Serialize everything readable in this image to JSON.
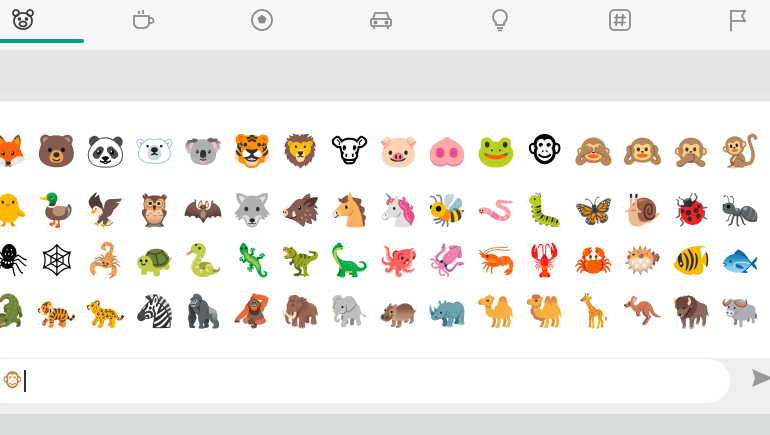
{
  "tabs": [
    {
      "id": "animals",
      "icon": "bear-face-icon",
      "selected": true
    },
    {
      "id": "food",
      "icon": "coffee-cup-icon",
      "selected": false
    },
    {
      "id": "activity",
      "icon": "soccer-ball-icon",
      "selected": false
    },
    {
      "id": "travel",
      "icon": "car-icon",
      "selected": false
    },
    {
      "id": "objects",
      "icon": "light-bulb-icon",
      "selected": false
    },
    {
      "id": "symbols",
      "icon": "hash-symbol-icon",
      "selected": false
    },
    {
      "id": "flags",
      "icon": "flag-icon",
      "selected": false
    }
  ],
  "colors": {
    "accent": "#0a9b86",
    "tab_icon": "#8a8a8a",
    "panel_bg": "#ffffff",
    "input_bg": "#ffffff"
  },
  "emoji_rows": [
    [
      "🦊",
      "🐻",
      "🐼",
      "🐻‍❄️",
      "🐨",
      "🐯",
      "🦁",
      "🐮",
      "🐷",
      "🐽",
      "🐸",
      "🐵",
      "🙈",
      "🙉",
      "🙊",
      "🐒"
    ],
    [
      "🐥",
      "🦆",
      "🦅",
      "🦉",
      "🦇",
      "🐺",
      "🐗",
      "🐴",
      "🦄",
      "🐝",
      "🪱",
      "🐛",
      "🦋",
      "🐌",
      "🐞",
      "🐜"
    ],
    [
      "🕷",
      "🕸",
      "🦂",
      "🐢",
      "🐍",
      "🦎",
      "🦖",
      "🦕",
      "🐙",
      "🦑",
      "🦐",
      "🦞",
      "🦀",
      "🐡",
      "🐠",
      "🐟"
    ],
    [
      "🐊",
      "🐅",
      "🐆",
      "🦓",
      "🦍",
      "🦧",
      "🦣",
      "🐘",
      "🦛",
      "🦏",
      "🐪",
      "🐫",
      "🦒",
      "🦘",
      "🦬",
      "🐃"
    ]
  ],
  "composer": {
    "input_value": "🐵",
    "send_icon": "send-arrow-icon"
  }
}
